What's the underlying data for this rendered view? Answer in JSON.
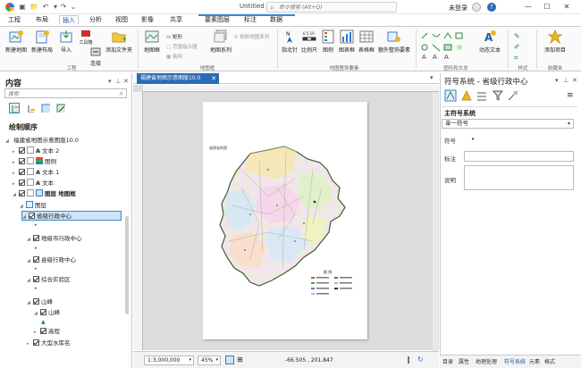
{
  "title_bar": {
    "doc_title": "Untitled",
    "search_placeholder": "命令搜索 (Alt+Q)",
    "user": "未登录",
    "help": "?"
  },
  "ribbon": {
    "tabs": [
      {
        "label": "工程"
      },
      {
        "label": "布局"
      },
      {
        "label": "插入"
      },
      {
        "label": "分析"
      },
      {
        "label": "视图"
      },
      {
        "label": "影像"
      },
      {
        "label": "共享"
      },
      {
        "label": "要素图层"
      },
      {
        "label": "标注"
      },
      {
        "label": "数据"
      }
    ],
    "active_tab_index": 2,
    "groups": {
      "project": "工程",
      "map_frame": "地图框",
      "map_elements": "地图整饰要素",
      "graphics_text": "图形和文本",
      "styles": "样式",
      "favorites": "收藏夹"
    },
    "buttons": {
      "new_map": "新建地图",
      "new_layout": "新建布局",
      "import": "导入",
      "toolbox": "工具箱",
      "connect": "连接",
      "add_folder": "添加文件夹",
      "map_frame": "地图框",
      "rectangle": "矩形",
      "extent_indicator": "范围指示器",
      "grid": "格网",
      "map_series": "地图系列",
      "refresh_map_series": "刷新地图系列",
      "north_arrow": "指北针",
      "scale_bar": "比例尺",
      "legend": "图例",
      "chart_frame": "图表框",
      "table_frame": "表格框",
      "extra_elements": "额外整饰要素",
      "dynamic_text": "动态文本",
      "add_item": "添加项目"
    }
  },
  "contents": {
    "title": "内容",
    "filter_placeholder": "搜索",
    "draw_order": "绘制顺序",
    "map_name": "福建省地图示意图版10.0",
    "items": [
      {
        "label": "文本 2",
        "kind": "text",
        "checked": true
      },
      {
        "label": "图例",
        "kind": "legend",
        "checked": true
      },
      {
        "label": "文本 1",
        "kind": "text",
        "checked": true
      },
      {
        "label": "文本",
        "kind": "text",
        "checked": true
      },
      {
        "label": "图层 地图框",
        "kind": "frame",
        "checked": true
      },
      {
        "label": "图层",
        "kind": "group",
        "checked": false
      },
      {
        "label": "省级行政中心",
        "kind": "layer",
        "checked": true,
        "selected": true
      },
      {
        "label": "地级市行政中心",
        "kind": "layer",
        "checked": true
      },
      {
        "label": "县级行政中心",
        "kind": "layer",
        "checked": true
      },
      {
        "label": "综合实验区",
        "kind": "layer",
        "checked": true
      },
      {
        "label": "山峰",
        "kind": "layer",
        "checked": true
      },
      {
        "label": "山峰",
        "kind": "sublayer",
        "checked": true
      },
      {
        "label": "高程",
        "kind": "sublayer",
        "checked": true
      },
      {
        "label": "大型水库名",
        "kind": "layer",
        "checked": true
      }
    ]
  },
  "view": {
    "tab_label": "福建省地图示意图版10.0",
    "scale": "1:3,000,000",
    "zoom": "45%",
    "coords": "-66.505 , 201.847"
  },
  "map": {
    "title": "福建省地图",
    "legend_title": "图 例"
  },
  "symbology": {
    "title": "符号系统 - 省级行政中心",
    "primary_label": "主符号系统",
    "primary_value": "单一符号",
    "symbol_label": "符号",
    "label_label": "标注",
    "description_label": "说明"
  },
  "bottom_tabs": [
    {
      "label": "目录"
    },
    {
      "label": "属性"
    },
    {
      "label": "地理处理"
    },
    {
      "label": "符号系统",
      "active": true
    },
    {
      "label": "元素"
    },
    {
      "label": "格式"
    }
  ],
  "colors": {
    "accent": "#2b6cb8",
    "selection": "#cde3f7"
  }
}
